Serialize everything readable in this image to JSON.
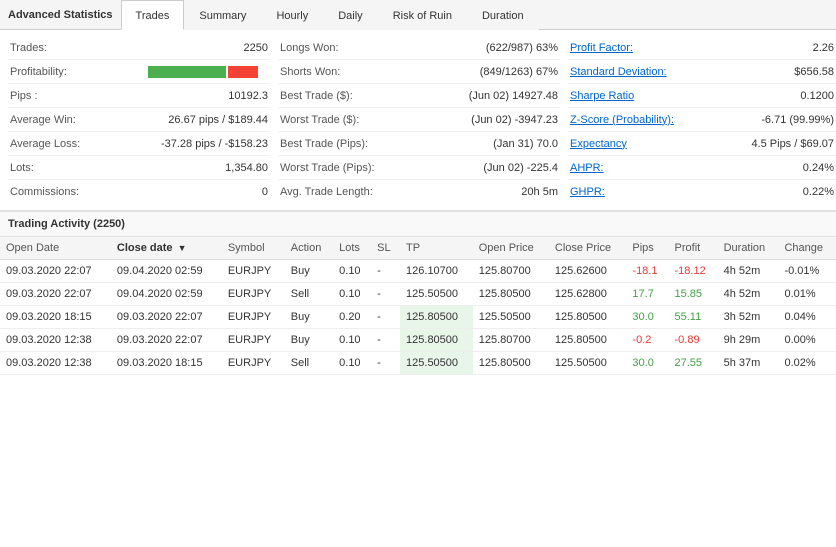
{
  "app": {
    "title": "Advanced Statistics"
  },
  "tabs": [
    {
      "id": "trades",
      "label": "Trades",
      "active": true
    },
    {
      "id": "summary",
      "label": "Summary",
      "active": false
    },
    {
      "id": "hourly",
      "label": "Hourly",
      "active": false
    },
    {
      "id": "daily",
      "label": "Daily",
      "active": false
    },
    {
      "id": "risk",
      "label": "Risk of Ruin",
      "active": false
    },
    {
      "id": "duration",
      "label": "Duration",
      "active": false
    }
  ],
  "stats": {
    "col1": [
      {
        "label": "Trades:",
        "value": "2250"
      },
      {
        "label": "Profitability:",
        "value": "bar"
      },
      {
        "label": "Pips :",
        "value": "10192.3"
      },
      {
        "label": "Average Win:",
        "value": "26.67 pips / $189.44"
      },
      {
        "label": "Average Loss:",
        "value": "-37.28 pips / -$158.23"
      },
      {
        "label": "Lots:",
        "value": "1,354.80"
      },
      {
        "label": "Commissions:",
        "value": "0"
      }
    ],
    "col2": [
      {
        "label": "Longs Won:",
        "value": "(622/987) 63%"
      },
      {
        "label": "Shorts Won:",
        "value": "(849/1263) 67%"
      },
      {
        "label": "Best Trade ($):",
        "value": "(Jun 02) 14927.48"
      },
      {
        "label": "Worst Trade ($):",
        "value": "(Jun 02) -3947.23"
      },
      {
        "label": "Best Trade (Pips):",
        "value": "(Jan 31) 70.0"
      },
      {
        "label": "Worst Trade (Pips):",
        "value": "(Jun 02) -225.4"
      },
      {
        "label": "Avg. Trade Length:",
        "value": "20h 5m"
      }
    ],
    "col3": [
      {
        "label": "Profit Factor:",
        "value": "2.26",
        "link": true
      },
      {
        "label": "Standard Deviation:",
        "value": "$656.58",
        "link": true
      },
      {
        "label": "Sharpe Ratio",
        "value": "0.1200",
        "link": true
      },
      {
        "label": "Z-Score (Probability):",
        "value": "-6.71 (99.99%)",
        "link": true
      },
      {
        "label": "Expectancy",
        "value": "4.5 Pips / $69.07",
        "link": true
      },
      {
        "label": "AHPR:",
        "value": "0.24%",
        "link": true
      },
      {
        "label": "GHPR:",
        "value": "0.22%",
        "link": true
      }
    ]
  },
  "trading_activity": {
    "title": "Trading Activity (2250)",
    "columns": [
      "Open Date",
      "Close date ▼",
      "Symbol",
      "Action",
      "Lots",
      "SL",
      "TP",
      "Open Price",
      "Close Price",
      "Pips",
      "Profit",
      "Duration",
      "Change"
    ],
    "rows": [
      {
        "open_date": "09.03.2020 22:07",
        "close_date": "09.04.2020 02:59",
        "symbol": "EURJPY",
        "action": "Buy",
        "lots": "0.10",
        "sl": "-",
        "tp": "126.10700",
        "open_price": "125.80700",
        "close_price": "125.62600",
        "pips": "-18.1",
        "profit": "-18.12",
        "duration": "4h 52m",
        "change": "-0.01%",
        "pips_neg": true,
        "profit_neg": true,
        "tp_highlight": false
      },
      {
        "open_date": "09.03.2020 22:07",
        "close_date": "09.04.2020 02:59",
        "symbol": "EURJPY",
        "action": "Sell",
        "lots": "0.10",
        "sl": "-",
        "tp": "125.50500",
        "open_price": "125.80500",
        "close_price": "125.62800",
        "pips": "17.7",
        "profit": "15.85",
        "duration": "4h 52m",
        "change": "0.01%",
        "pips_neg": false,
        "profit_neg": false,
        "tp_highlight": false
      },
      {
        "open_date": "09.03.2020 18:15",
        "close_date": "09.03.2020 22:07",
        "symbol": "EURJPY",
        "action": "Buy",
        "lots": "0.20",
        "sl": "-",
        "tp": "125.80500",
        "open_price": "125.50500",
        "close_price": "125.80500",
        "pips": "30.0",
        "profit": "55.11",
        "duration": "3h 52m",
        "change": "0.04%",
        "pips_neg": false,
        "profit_neg": false,
        "tp_highlight": true
      },
      {
        "open_date": "09.03.2020 12:38",
        "close_date": "09.03.2020 22:07",
        "symbol": "EURJPY",
        "action": "Buy",
        "lots": "0.10",
        "sl": "-",
        "tp": "125.80500",
        "open_price": "125.80700",
        "close_price": "125.80500",
        "pips": "-0.2",
        "profit": "-0.89",
        "duration": "9h 29m",
        "change": "0.00%",
        "pips_neg": true,
        "profit_neg": true,
        "tp_highlight": true
      },
      {
        "open_date": "09.03.2020 12:38",
        "close_date": "09.03.2020 18:15",
        "symbol": "EURJPY",
        "action": "Sell",
        "lots": "0.10",
        "sl": "-",
        "tp": "125.50500",
        "open_price": "125.80500",
        "close_price": "125.50500",
        "pips": "30.0",
        "profit": "27.55",
        "duration": "5h 37m",
        "change": "0.02%",
        "pips_neg": false,
        "profit_neg": false,
        "tp_highlight": true
      }
    ]
  }
}
